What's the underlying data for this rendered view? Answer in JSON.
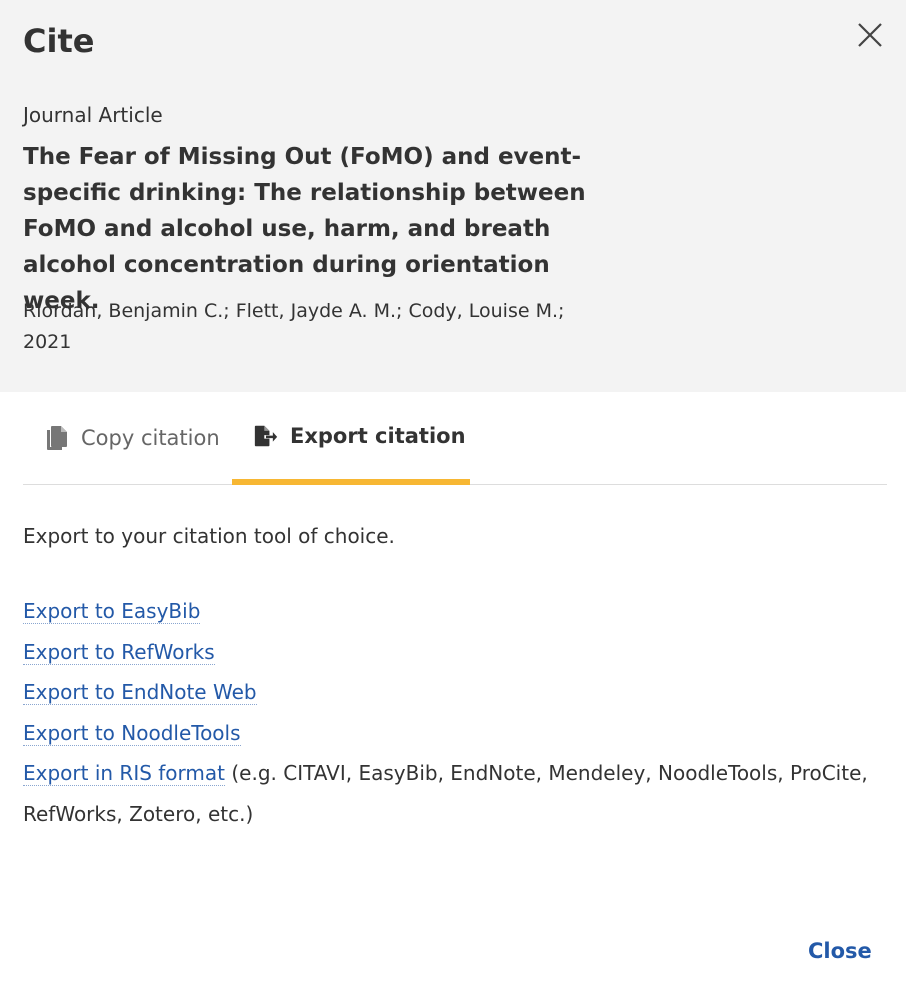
{
  "dialog": {
    "title": "Cite",
    "close_label": "Close"
  },
  "item": {
    "type": "Journal Article",
    "title": "The Fear of Missing Out (FoMO) and event-specific drinking: The relationship between FoMO and alcohol use, harm, and breath alcohol concentration during orientation week.",
    "authors": "Riordan, Benjamin C.; Flett, Jayde A. M.; Cody, Louise M.;",
    "year": "2021"
  },
  "tabs": [
    {
      "label": "Copy citation",
      "icon": "copy-icon",
      "active": false
    },
    {
      "label": "Export citation",
      "icon": "export-icon",
      "active": true
    }
  ],
  "export": {
    "intro": "Export to your citation tool of choice.",
    "links": [
      {
        "label": "Export to EasyBib"
      },
      {
        "label": "Export to RefWorks"
      },
      {
        "label": "Export to EndNote Web"
      },
      {
        "label": "Export to NoodleTools"
      },
      {
        "label": "Export in RIS format",
        "note": " (e.g. CITAVI, EasyBib, EndNote, Mendeley, NoodleTools, ProCite, RefWorks, Zotero, etc.)"
      }
    ]
  },
  "colors": {
    "accent": "#f7b733",
    "link": "#2359a8",
    "header_bg": "#f3f3f3"
  }
}
